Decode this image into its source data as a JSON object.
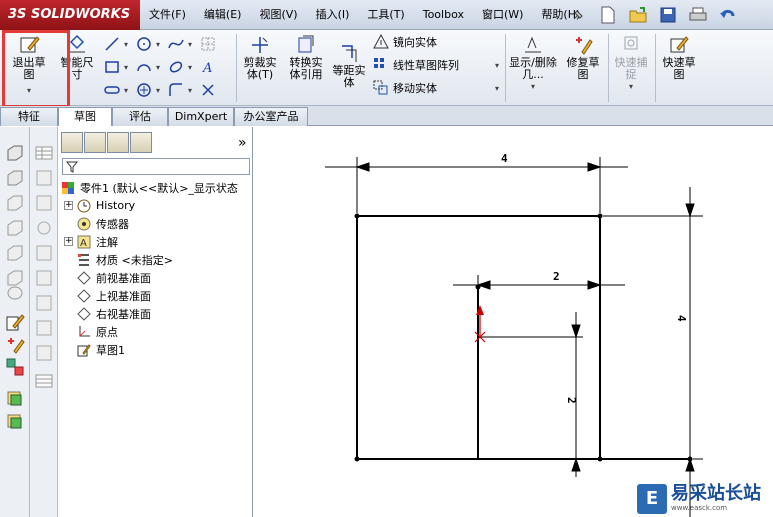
{
  "app": {
    "logo_text": "SOLIDWORKS",
    "logo_prefix": "3S"
  },
  "menu": [
    "文件(F)",
    "编辑(E)",
    "视图(V)",
    "插入(I)",
    "工具(T)",
    "Toolbox",
    "窗口(W)",
    "帮助(H)"
  ],
  "ribbon": {
    "exit_sketch": "退出草图",
    "smart_dim": "智能尺寸",
    "trim": "剪裁实体(T)",
    "convert": "转换实体引用",
    "offset": "等距实体",
    "mirror": "镜向实体",
    "linear_pattern": "线性草图阵列",
    "move": "移动实体",
    "show_hide": "显示/删除几...",
    "repair": "修复草图",
    "quick_snap": "快速捕捉",
    "rapid_sketch": "快速草图"
  },
  "tabs": [
    "特征",
    "草图",
    "评估",
    "DimXpert",
    "办公室产品"
  ],
  "active_tab": "草图",
  "tree": {
    "root": "零件1 (默认<<默认>_显示状态",
    "items": [
      "History",
      "传感器",
      "注解",
      "材质 <未指定>",
      "前视基准面",
      "上视基准面",
      "右视基准面",
      "原点",
      "草图1"
    ]
  },
  "fm_more": "»",
  "dimensions": {
    "top": "4",
    "right": "4",
    "inner_top": "2",
    "inner_left": "2"
  },
  "watermark": {
    "title": "易采站长站",
    "url": "www.easck.com"
  },
  "colors": {
    "highlight": "#e23a36",
    "accent": "#c0272d"
  }
}
